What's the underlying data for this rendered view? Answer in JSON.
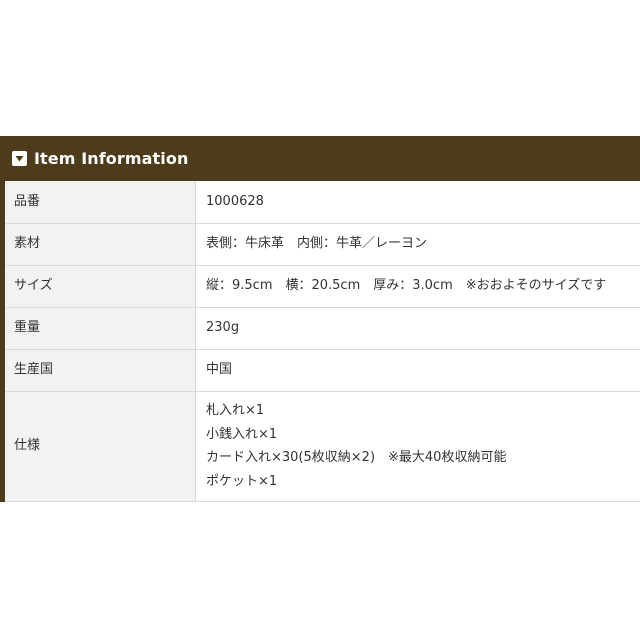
{
  "section": {
    "title": "Item Information",
    "icon": "chevron-down-icon",
    "colors": {
      "header_bg": "#4d3b19",
      "label_bg": "#f2f2f2",
      "border": "#d9d9d9"
    }
  },
  "rows": [
    {
      "label": "品番",
      "value": "1000628"
    },
    {
      "label": "素材",
      "value": "表側：牛床革　内側：牛革／レーヨン"
    },
    {
      "label": "サイズ",
      "value": "縦：9.5cm　横：20.5cm　厚み：3.0cm　※おおよそのサイズです"
    },
    {
      "label": "重量",
      "value": "230g"
    },
    {
      "label": "生産国",
      "value": "中国"
    },
    {
      "label": "仕様",
      "lines": [
        "札入れ×1",
        "小銭入れ×1",
        "カード入れ×30(5枚収納×2)　※最大40枚収納可能",
        "ポケット×1"
      ]
    }
  ]
}
